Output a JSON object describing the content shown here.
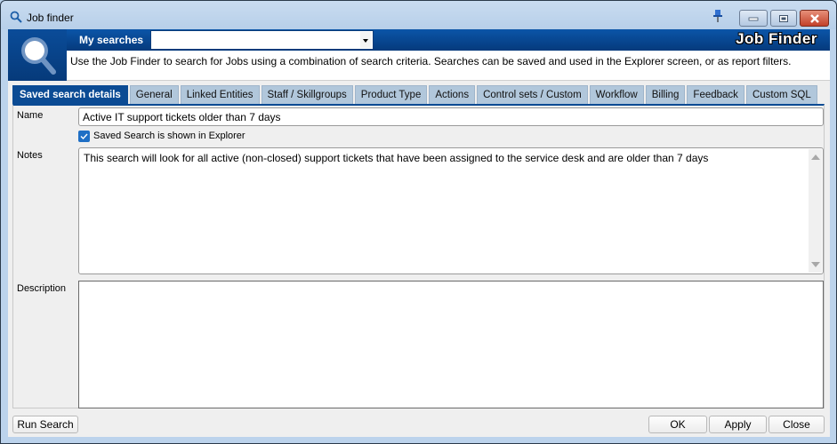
{
  "window": {
    "title": "Job finder",
    "icons": {
      "title": "search-icon",
      "pin": "pin-icon",
      "minimize": "minimize-icon",
      "maximize": "maximize-icon",
      "close": "close-icon"
    }
  },
  "header": {
    "my_searches_label": "My searches",
    "my_searches_value": "",
    "app_title": "Job Finder",
    "description": "Use the Job Finder to search for Jobs using a combination of search criteria.  Searches can be saved and used in the Explorer screen, or as report filters.",
    "logo_icon": "magnifier-icon"
  },
  "tabs": [
    {
      "label": "Saved search details",
      "active": true
    },
    {
      "label": "General",
      "active": false
    },
    {
      "label": "Linked Entities",
      "active": false
    },
    {
      "label": "Staff / Skillgroups",
      "active": false
    },
    {
      "label": "Product Type",
      "active": false
    },
    {
      "label": "Actions",
      "active": false
    },
    {
      "label": "Control sets / Custom",
      "active": false
    },
    {
      "label": "Workflow",
      "active": false
    },
    {
      "label": "Billing",
      "active": false
    },
    {
      "label": "Feedback",
      "active": false
    },
    {
      "label": "Custom SQL",
      "active": false
    }
  ],
  "form": {
    "name_label": "Name",
    "name_value": "Active IT support tickets older than 7 days",
    "shown_in_explorer_label": "Saved Search is shown in Explorer",
    "shown_in_explorer_checked": true,
    "notes_label": "Notes",
    "notes_value": "This search will look for all active (non-closed) support tickets that have been assigned to the service desk and are older than 7 days",
    "description_label": "Description",
    "description_value": ""
  },
  "buttons": {
    "run_search": "Run Search",
    "ok": "OK",
    "apply": "Apply",
    "close": "Close"
  },
  "colors": {
    "accent": "#0b4b94",
    "tab_inactive": "#b1c7db",
    "close_button": "#c3412a"
  }
}
